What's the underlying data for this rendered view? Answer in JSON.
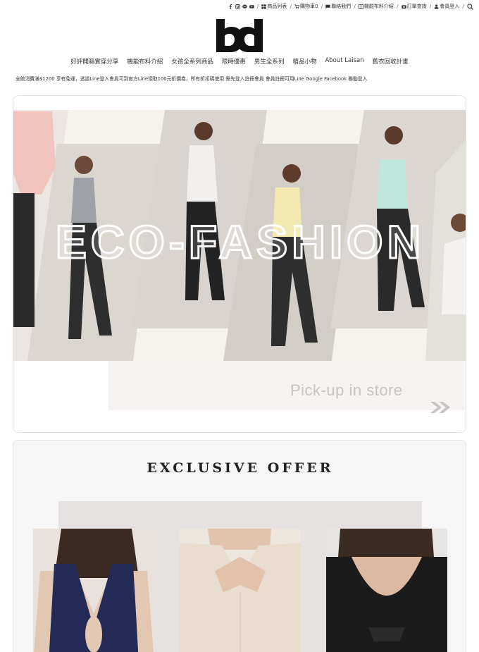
{
  "topbar": {
    "icons": [
      "facebook-icon",
      "instagram-icon",
      "line-icon",
      "youtube-icon"
    ],
    "links": [
      {
        "label": "商品列表",
        "icon": "grid-icon"
      },
      {
        "label": "購物車0",
        "icon": "cart-icon"
      },
      {
        "label": "聯絡我們",
        "icon": "chat-icon"
      },
      {
        "label": "機能布料介紹",
        "icon": "book-icon"
      },
      {
        "label": "訂單查詢",
        "icon": "camera-icon"
      },
      {
        "label": "會員登入",
        "icon": "user-icon"
      }
    ],
    "separator": "/"
  },
  "logo": {
    "text": "bd",
    "color": "#111111"
  },
  "nav": {
    "items": [
      "好評開箱實穿分享",
      "機能布料介紹",
      "女孩全系列商品",
      "限時優惠",
      "男生全系列",
      "精品小物",
      "About Laisan",
      "舊衣回收計畫"
    ]
  },
  "promo": {
    "text": "全館消費滿$1200 享有免運，透過Line登入會員可到官方Line領取100元折價卷，所有折扣碼使用 需先登入註冊會員 會員註冊可用Line Google Facebook 聯動登入"
  },
  "banner": {
    "headline": "ECO-FASHION",
    "pickup": "Pick-up in store"
  },
  "offer": {
    "title": "EXCLUSIVE OFFER"
  },
  "colors": {
    "accent": "#111111",
    "banner_bg": "#f6f3ef",
    "pickup_text": "#c9c3c3",
    "navy_top": "#232a56",
    "black_top": "#1b1b1b",
    "beige_top": "#e9ddd0"
  }
}
